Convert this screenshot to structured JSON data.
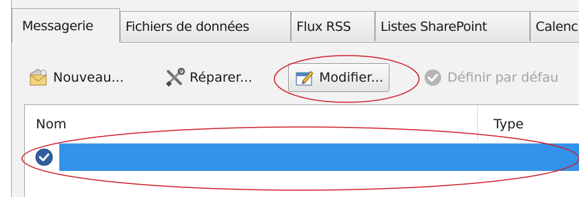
{
  "tabs": [
    {
      "label": "Messagerie",
      "active": true
    },
    {
      "label": "Fichiers de données",
      "active": false
    },
    {
      "label": "Flux RSS",
      "active": false
    },
    {
      "label": "Listes SharePoint",
      "active": false
    },
    {
      "label": "Calenc",
      "active": false
    }
  ],
  "toolbar": {
    "new_label": "Nouveau...",
    "repair_label": "Réparer...",
    "modify_label": "Modifier...",
    "default_label": "Définir par défau"
  },
  "list": {
    "columns": [
      "Nom",
      "Type"
    ],
    "rows": [
      {
        "name": "",
        "type": "",
        "selected": true
      }
    ]
  },
  "colors": {
    "selection": "#3392ea",
    "annotation": "#d01f2a"
  },
  "icons": [
    "new-account-icon",
    "repair-tools-icon",
    "modify-icon",
    "set-default-check-icon",
    "account-check-icon"
  ]
}
